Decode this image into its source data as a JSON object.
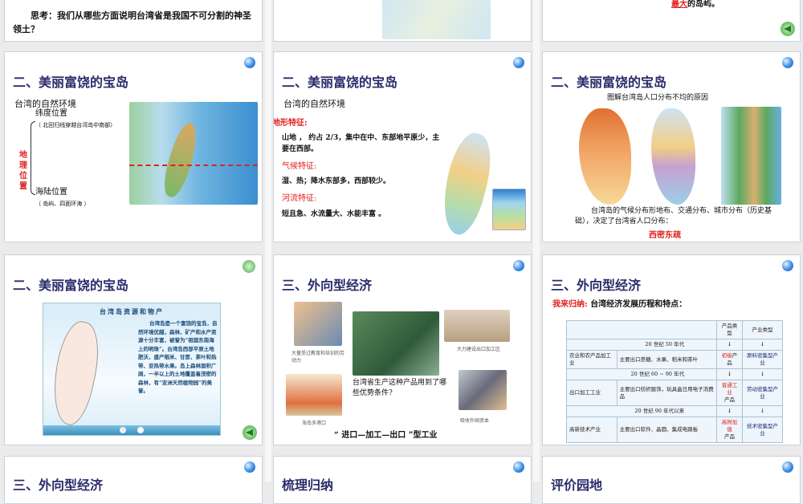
{
  "row1": {
    "slide_left": {
      "text": "思考：我们从哪些方面说明台湾省是我国不可分割的神圣领土？"
    },
    "slide_right": {
      "highlight": "最大",
      "text": "的岛屿。"
    }
  },
  "slides": {
    "s1": {
      "title": "二、美丽富饶的宝岛",
      "subtitle": "台湾的自然环境",
      "bracket_label": "地理位置",
      "lat_label": "纬度位置",
      "lat_note": "（ 北回归线穿越台湾岛中南部）",
      "sea_label": "海陆位置",
      "sea_note": "（ 岛屿、四面环海 ）"
    },
    "s2": {
      "title": "二、美丽富饶的宝岛",
      "subtitle": "台湾的自然环境",
      "terrain_h": "地形特征:",
      "terrain": "山地 ， 约占 2/3，集中在中、东部地平原少，主要在西部。",
      "climate_h": "气候特征:",
      "climate": "湿、热；降水东部多，西部较少。",
      "river_h": "河流特征:",
      "river": "短且急、水流量大、水能丰富 。"
    },
    "s3": {
      "title": "二、美丽富饶的宝岛",
      "subtitle": "图解台湾岛人口分布不均的原因",
      "text": "台湾岛的气候分布形地布、交通分布、城市分布（历史基础），决定了台湾省人口分布：",
      "conclusion": "西密东疏"
    },
    "s4": {
      "title": "二、美丽富饶的宝岛",
      "panel_title": "台湾岛资源和物产",
      "panel_text": "台湾岛是一个富饶的宝岛，自然环境优越，森林、矿产和水产资源十分丰富，被誉为“祖国东南海上的明珠”。台湾岛西部平原土地肥沃，盛产稻米、甘蔗、茶叶和热带、亚热带水果。岛上森林面积广阔，一半以上的土地覆盖着茂密的森林，有“亚洲天然植物园”的美誉。"
    },
    "s5": {
      "title": "三、外向型经济",
      "cap_labor": "大量受过教育和培训的劳动力",
      "cap_zone": "大力建设出口加工区",
      "cap_port": "海岛多港口",
      "cap_capital": "吸收外国资本",
      "question": "台湾省生产这种产品用到了哪些优势条件?",
      "footer": "“ 进口—加工—出口 ”型工业"
    },
    "s6": {
      "title": "三、外向型经济",
      "lead": "我来归纳:",
      "lead_text": "台湾经济发展历程和特点：",
      "headers": [
        "产品类型",
        "产业类型"
      ],
      "periods": [
        {
          "era": "20 世纪 50 年代",
          "industry": "农业和农产品加工业",
          "exports": "主要出口蔗糖、水果、稻米和茶叶",
          "product_hl": "初级",
          "product": "产品",
          "type": "原料密集型产业"
        },
        {
          "era": "20 世纪 60 ~ 90 年代",
          "industry": "出口加工工业",
          "exports": "主要出口纺织服饰，玩具盒日用电子消费品",
          "product_hl": "普通工业",
          "product": "产品",
          "type": "劳动密集型产业"
        },
        {
          "era": "20 世纪 90 年代以来",
          "industry": "高新技术产业",
          "exports": "主要出口软件、晶圆、集成电路板",
          "product_hl": "高附加值",
          "product": "产品",
          "type": "技术密集型产业"
        }
      ]
    },
    "s7": {
      "title": "三、外向型经济"
    },
    "s8": {
      "title": "梳理归纳"
    },
    "s9": {
      "title": "评价园地"
    }
  }
}
